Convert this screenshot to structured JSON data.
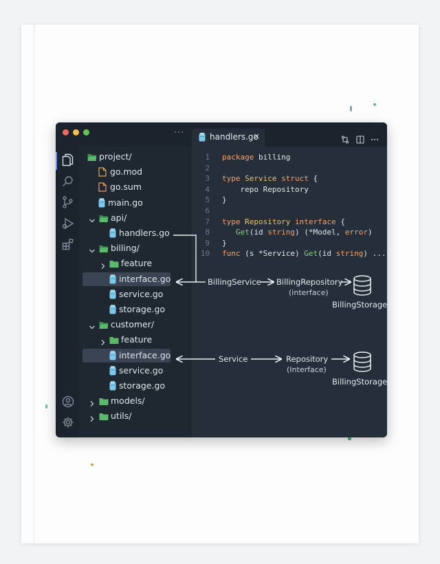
{
  "colors": {
    "bg": "#f1f3f5",
    "paper": "#fdfdfe",
    "titlebar": "#1c232c",
    "sidebar": "#1f2731",
    "editor": "#252e39",
    "text": "#dfe5eb",
    "go_file": "#7ec8ea",
    "folder": "#5cb86a",
    "file_orange": "#e3a15e",
    "keyword": "#f0a36b",
    "type": "#e8c46a",
    "function": "#88c98a",
    "selection": "#3a4452",
    "traffic_red": "#ed6a5e",
    "traffic_yellow": "#f5bf4f",
    "traffic_green": "#61c554"
  },
  "sidebar": {
    "more_label": "···",
    "tree": [
      {
        "label": "project/",
        "type": "folder-open",
        "depth": 0,
        "expanded": true
      },
      {
        "label": "go.mod",
        "type": "file",
        "depth": 1
      },
      {
        "label": "go.sum",
        "type": "file",
        "depth": 1
      },
      {
        "label": "main.go",
        "type": "go",
        "depth": 1
      },
      {
        "label": "api/",
        "type": "folder-open",
        "depth": 1,
        "expanded": true
      },
      {
        "label": "handlers.go",
        "type": "go",
        "depth": 2
      },
      {
        "label": "billing/",
        "type": "folder-open",
        "depth": 1,
        "expanded": true
      },
      {
        "label": "feature",
        "type": "folder",
        "depth": 2,
        "expanded": false
      },
      {
        "label": "interface.go",
        "type": "go",
        "depth": 2,
        "selected": true
      },
      {
        "label": "service.go",
        "type": "go",
        "depth": 2
      },
      {
        "label": "storage.go",
        "type": "go",
        "depth": 2
      },
      {
        "label": "customer/",
        "type": "folder-open",
        "depth": 1,
        "expanded": true
      },
      {
        "label": "feature",
        "type": "folder",
        "depth": 2,
        "expanded": false
      },
      {
        "label": "interface.go",
        "type": "go",
        "depth": 2,
        "selected": true
      },
      {
        "label": "service.go",
        "type": "go",
        "depth": 2
      },
      {
        "label": "storage.go",
        "type": "go",
        "depth": 2
      },
      {
        "label": "models/",
        "type": "folder",
        "depth": 1,
        "expanded": false
      },
      {
        "label": "utils/",
        "type": "folder",
        "depth": 1,
        "expanded": false
      }
    ]
  },
  "tab": {
    "label": "handlers.go",
    "close": "×"
  },
  "editor": {
    "lines": [
      {
        "n": "1",
        "tokens": [
          {
            "t": "package",
            "c": "kw"
          },
          {
            "t": " billing",
            "c": "pl"
          }
        ]
      },
      {
        "n": "2",
        "tokens": []
      },
      {
        "n": "3",
        "tokens": [
          {
            "t": "type",
            "c": "kw"
          },
          {
            "t": " ",
            "c": "pl"
          },
          {
            "t": "Service",
            "c": "ty"
          },
          {
            "t": " ",
            "c": "pl"
          },
          {
            "t": "struct",
            "c": "kw"
          },
          {
            "t": " {",
            "c": "pl"
          }
        ]
      },
      {
        "n": "4",
        "tokens": [
          {
            "t": "    repo Repository",
            "c": "pl"
          }
        ]
      },
      {
        "n": "5",
        "tokens": [
          {
            "t": "}",
            "c": "pl"
          }
        ]
      },
      {
        "n": "6",
        "tokens": []
      },
      {
        "n": "7",
        "tokens": [
          {
            "t": "type",
            "c": "kw"
          },
          {
            "t": " ",
            "c": "pl"
          },
          {
            "t": "Repository",
            "c": "ty"
          },
          {
            "t": " ",
            "c": "pl"
          },
          {
            "t": "interface",
            "c": "kw"
          },
          {
            "t": " {",
            "c": "pl"
          }
        ]
      },
      {
        "n": "8",
        "tokens": [
          {
            "t": "   ",
            "c": "pl"
          },
          {
            "t": "Get",
            "c": "fn"
          },
          {
            "t": "(id ",
            "c": "pl"
          },
          {
            "t": "string",
            "c": "kw"
          },
          {
            "t": ") (*Model, ",
            "c": "pl"
          },
          {
            "t": "error",
            "c": "kw"
          },
          {
            "t": ")",
            "c": "pl"
          }
        ]
      },
      {
        "n": "9",
        "tokens": [
          {
            "t": "}",
            "c": "pl"
          }
        ]
      },
      {
        "n": "10",
        "tokens": [
          {
            "t": "func",
            "c": "kw"
          },
          {
            "t": " (s *Service) ",
            "c": "pl"
          },
          {
            "t": "Get",
            "c": "fn"
          },
          {
            "t": "(id ",
            "c": "pl"
          },
          {
            "t": "string",
            "c": "kw"
          },
          {
            "t": ") ...",
            "c": "pl"
          }
        ]
      }
    ]
  },
  "diagram": {
    "billing": {
      "service": "BillingService",
      "repository": "BillingRepository",
      "repository_sub": "(interface)",
      "storage": "BillingStorage"
    },
    "customer": {
      "service": "Service",
      "repository": "Repository",
      "repository_sub": "(Interface)",
      "storage": "BillingStorage"
    }
  },
  "icons": {
    "activity": [
      "files-icon",
      "search-icon",
      "source-control-icon",
      "run-debug-icon",
      "extensions-icon",
      "account-icon",
      "settings-gear-icon"
    ],
    "title_actions": [
      "compare-changes-icon",
      "split-editor-icon",
      "more-actions-icon"
    ]
  }
}
